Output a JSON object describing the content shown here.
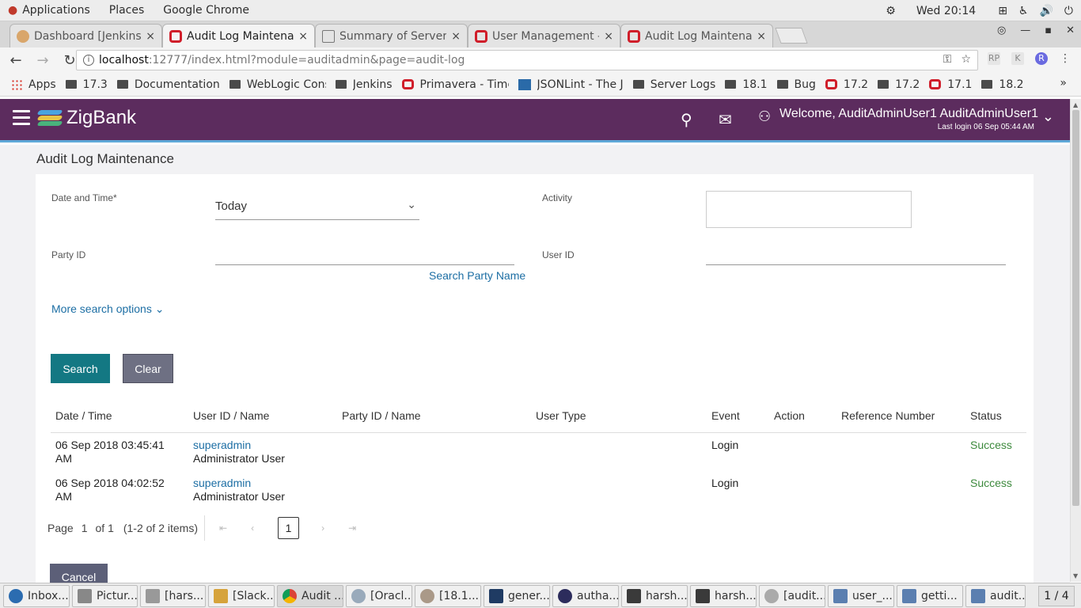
{
  "gnome": {
    "menus": [
      "Applications",
      "Places",
      "Google Chrome"
    ],
    "clock": "Wed 20:14"
  },
  "tabs": [
    {
      "title": "Dashboard [Jenkins]",
      "active": false
    },
    {
      "title": "Audit Log Maintenar",
      "active": true
    },
    {
      "title": "Summary of Servers",
      "active": false
    },
    {
      "title": "User Management -",
      "active": false
    },
    {
      "title": "Audit Log Maintenar",
      "active": false
    }
  ],
  "tab_close": "×",
  "address": {
    "host": "localhost",
    "path": ":12777/index.html?module=auditadmin&page=audit-log"
  },
  "bookmarks": [
    {
      "label": "Apps",
      "icon": "apps-grid"
    },
    {
      "label": "17.3",
      "icon": "folder"
    },
    {
      "label": "Documentation",
      "icon": "folder"
    },
    {
      "label": "WebLogic Consol",
      "icon": "folder"
    },
    {
      "label": "Jenkins",
      "icon": "folder"
    },
    {
      "label": "Primavera - Time",
      "icon": "oracle"
    },
    {
      "label": "JSONLint - The J",
      "icon": "json"
    },
    {
      "label": "Server Logs",
      "icon": "folder"
    },
    {
      "label": "18.1",
      "icon": "folder"
    },
    {
      "label": "Bug",
      "icon": "folder"
    },
    {
      "label": "17.2",
      "icon": "oracle"
    },
    {
      "label": "17.2",
      "icon": "folder"
    },
    {
      "label": "17.1",
      "icon": "oracle"
    },
    {
      "label": "18.2",
      "icon": "folder"
    }
  ],
  "bookmarks_more": "»",
  "header": {
    "brand": "ZigBank",
    "welcome": "Welcome, AuditAdminUser1 AuditAdminUser1",
    "last_login": "Last login 06 Sep 05:44 AM"
  },
  "page": {
    "title": "Audit Log Maintenance",
    "labels": {
      "date_time": "Date and Time*",
      "activity": "Activity",
      "party_id": "Party ID",
      "user_id": "User ID"
    },
    "date_value": "Today",
    "search_party_name": "Search Party Name",
    "more_search_options": "More search options",
    "search_button": "Search",
    "clear_button": "Clear",
    "cancel_button": "Cancel"
  },
  "table": {
    "headers": [
      "Date / Time",
      "User ID / Name",
      "Party ID / Name",
      "User Type",
      "Event",
      "Action",
      "Reference Number",
      "Status"
    ],
    "rows": [
      {
        "date1": "06 Sep 2018 03:45:41",
        "date2": "AM",
        "user_id": "superadmin",
        "user_name": "Administrator User",
        "event": "Login",
        "status": "Success"
      },
      {
        "date1": "06 Sep 2018 04:02:52",
        "date2": "AM",
        "user_id": "superadmin",
        "user_name": "Administrator User",
        "event": "Login",
        "status": "Success"
      }
    ]
  },
  "pager": {
    "page_label": "Page",
    "page_num": "1",
    "of_label": "of 1",
    "items": "(1-2 of 2 items)",
    "current": "1"
  },
  "taskbar": {
    "tasks": [
      "Inbox...",
      "Pictur...",
      "[hars...",
      "[Slack...",
      "Audit ...",
      "[Oracl...",
      "[18.1...",
      "gener...",
      "autha...",
      "harsh...",
      "harsh...",
      "[audit...",
      "user_...",
      "getti...",
      "audit..."
    ],
    "workspace": "1 / 4"
  },
  "colors": {
    "header_bg": "#5c2c5e",
    "primary_button": "#137883",
    "secondary_button": "#6e7083",
    "link": "#1c6ea4",
    "success": "#3d8a3d"
  }
}
